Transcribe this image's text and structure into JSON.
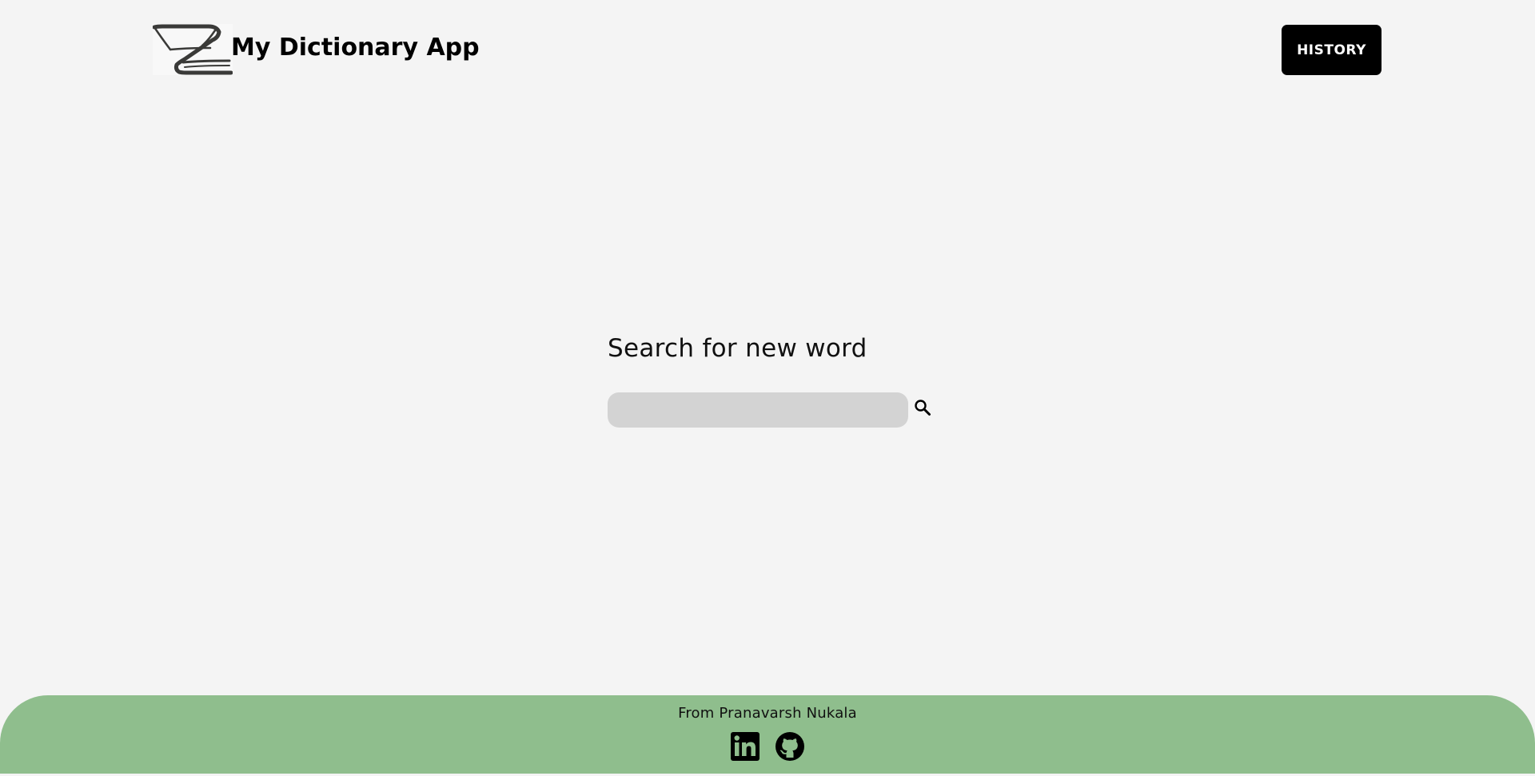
{
  "header": {
    "app_title": "My Dictionary App",
    "logo_icon": "book-logo-icon",
    "history_label": "HISTORY"
  },
  "search": {
    "heading": "Search for new word",
    "input_value": "",
    "input_placeholder": "",
    "search_icon": "magnifier-icon"
  },
  "footer": {
    "credit": "From Pranavarsh Nukala",
    "social_links": [
      {
        "name": "linkedin",
        "icon": "linkedin-icon"
      },
      {
        "name": "github",
        "icon": "github-icon"
      }
    ]
  },
  "colors": {
    "background": "#f4f4f4",
    "footer": "#8fbe8d",
    "button": "#000000",
    "input": "#d3d3d3"
  }
}
